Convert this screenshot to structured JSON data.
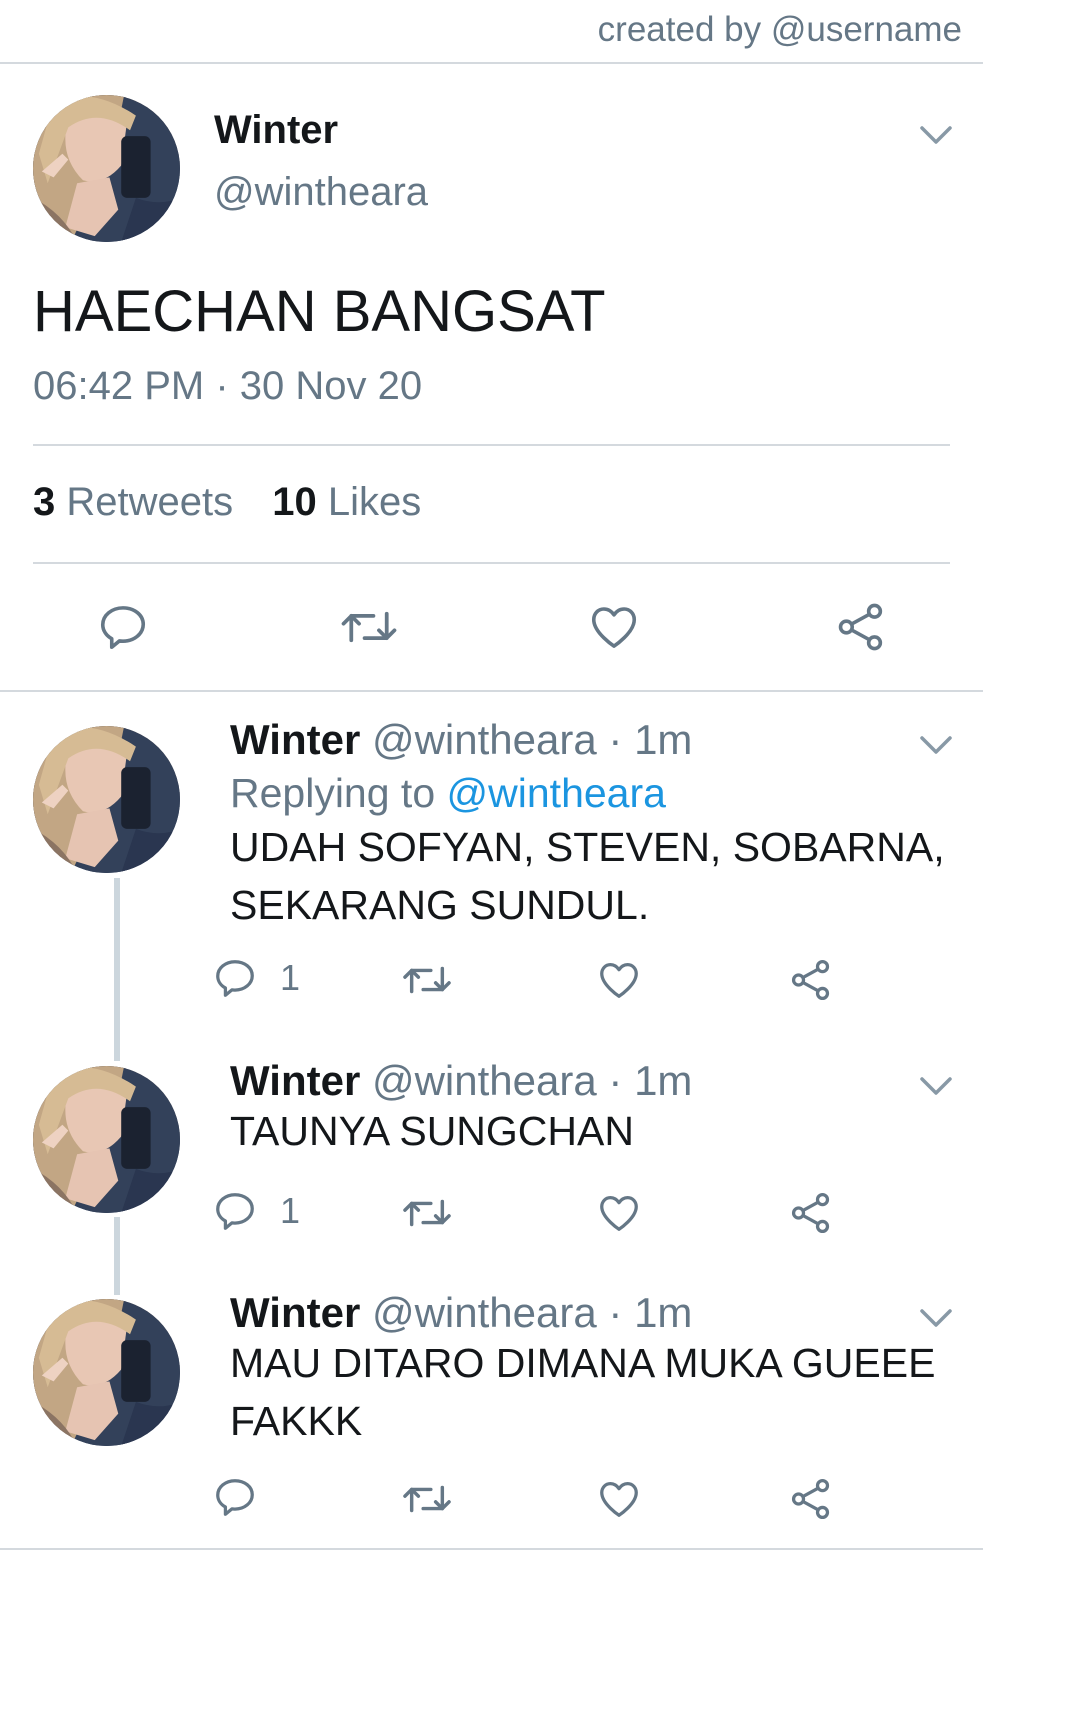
{
  "watermark": "created by @username",
  "main_tweet": {
    "name": "Winter",
    "handle": "@wintheara",
    "text": "HAECHAN BANGSAT",
    "time": "06:42 PM",
    "sep": "·",
    "date": "30 Nov 20",
    "retweets_count": "3",
    "retweets_label": "Retweets",
    "likes_count": "10",
    "likes_label": "Likes"
  },
  "replies": [
    {
      "name": "Winter",
      "handle": "@wintheara",
      "sep": "·",
      "age": "1m",
      "replying_prefix": "Replying to",
      "replying_handle": "@wintheara",
      "text": "UDAH SOFYAN, STEVEN, SOBARNA, SEKARANG SUNDUL.",
      "reply_count": "1"
    },
    {
      "name": "Winter",
      "handle": "@wintheara",
      "sep": "·",
      "age": "1m",
      "text": "TAUNYA SUNGCHAN",
      "reply_count": "1"
    },
    {
      "name": "Winter",
      "handle": "@wintheara",
      "sep": "·",
      "age": "1m",
      "text": "MAU DITARO DIMANA MUKA GUEEE FAKKK",
      "reply_count": ""
    }
  ],
  "icons": {
    "reply": "speech-bubble-icon",
    "retweet": "retweet-arrows-icon",
    "like": "heart-icon",
    "share": "share-nodes-icon",
    "menu": "chevron-down-icon"
  },
  "colors": {
    "text": "#14171a",
    "secondary": "#657786",
    "link": "#1b95e0",
    "divider": "#d4d9de",
    "thread": "#ccd6dd"
  }
}
